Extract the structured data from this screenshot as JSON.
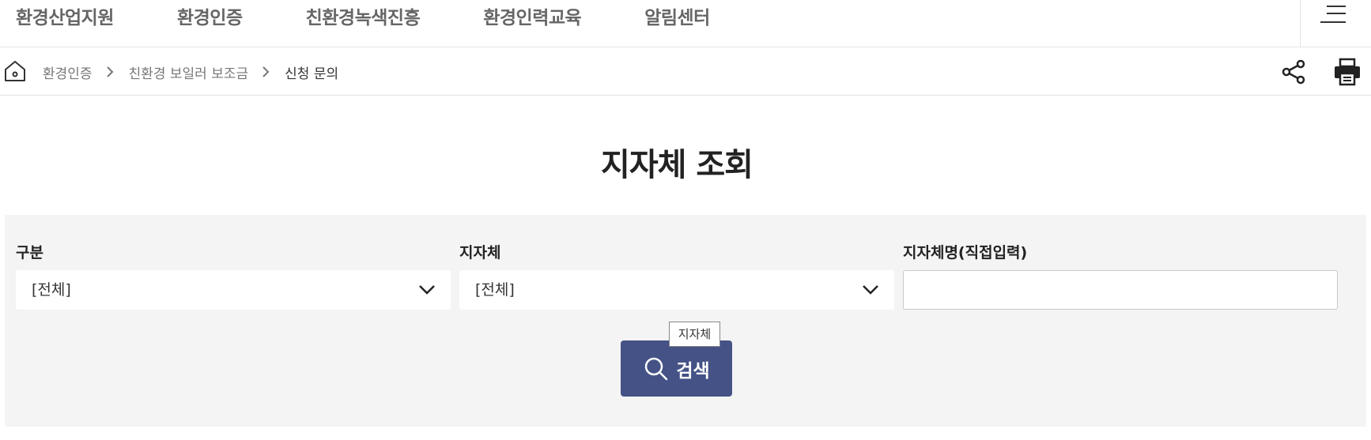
{
  "nav": {
    "items": [
      "환경산업지원",
      "환경인증",
      "친환경녹색진흥",
      "환경인력교육",
      "알림센터"
    ]
  },
  "breadcrumb": {
    "items": [
      "환경인증",
      "친환경 보일러 보조금"
    ],
    "current": "신청 문의"
  },
  "page": {
    "title": "지자체 조회"
  },
  "search": {
    "category": {
      "label": "구분",
      "value": "[전체]"
    },
    "municipality": {
      "label": "지자체",
      "value": "[전체]"
    },
    "municipality_name": {
      "label": "지자체명(직접입력)",
      "value": ""
    },
    "button_label": "검색",
    "tooltip": "지자체"
  },
  "colors": {
    "accent": "#445286",
    "panel_bg": "#f4f4f4"
  }
}
